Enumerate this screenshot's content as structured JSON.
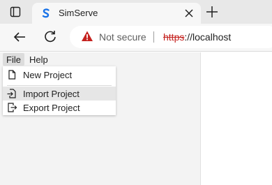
{
  "browser": {
    "tab": {
      "title": "SimServe"
    },
    "address": {
      "security_label": "Not secure",
      "url_scheme": "https",
      "url_rest": "://localhost"
    }
  },
  "app": {
    "menubar": {
      "file_label": "File",
      "help_label": "Help"
    },
    "file_menu": {
      "items": [
        {
          "label": "New Project",
          "icon": "new-file-icon"
        },
        {
          "label": "Import Project",
          "icon": "import-icon",
          "highlighted": true
        },
        {
          "label": "Export Project",
          "icon": "export-icon"
        }
      ]
    }
  },
  "colors": {
    "favicon": "#1a73e8",
    "warning": "#c5221f",
    "tabstrip": "#e8e8e8",
    "sidebar": "#f3f3f3"
  }
}
